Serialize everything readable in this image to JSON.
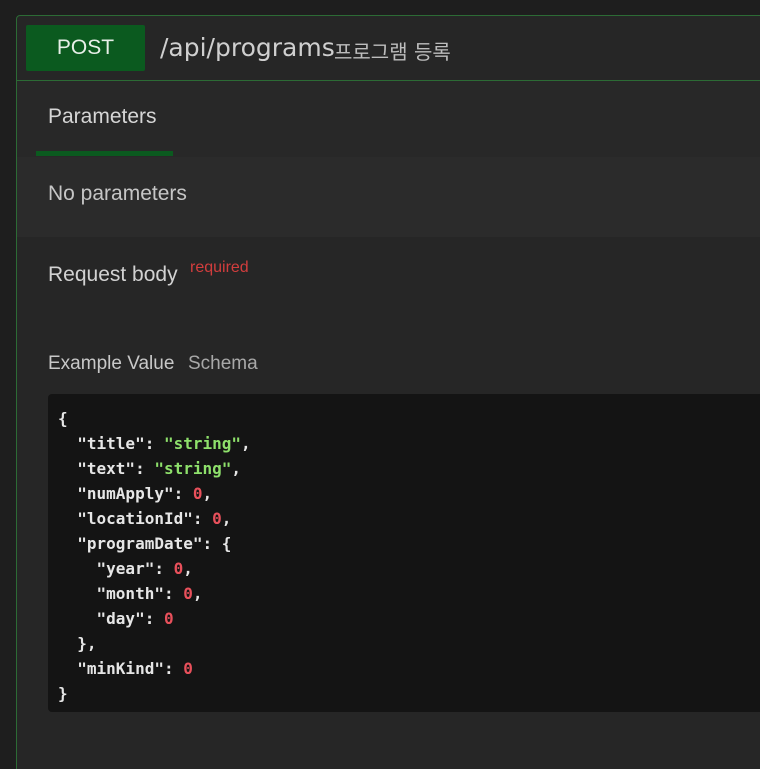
{
  "operation": {
    "method": "POST",
    "path": "/api/programs",
    "summary": "프로그램 등록"
  },
  "tabs": {
    "parameters_label": "Parameters"
  },
  "parameters": {
    "empty_text": "No parameters"
  },
  "request_body": {
    "title": "Request body",
    "required_label": "required",
    "example_tab": "Example Value",
    "schema_tab": "Schema"
  },
  "example_lines": [
    {
      "indent": 0,
      "parts": [
        {
          "t": "p",
          "v": "{"
        }
      ]
    },
    {
      "indent": 1,
      "parts": [
        {
          "t": "k",
          "v": "\"title\""
        },
        {
          "t": "p",
          "v": ": "
        },
        {
          "t": "s",
          "v": "\"string\""
        },
        {
          "t": "p",
          "v": ","
        }
      ]
    },
    {
      "indent": 1,
      "parts": [
        {
          "t": "k",
          "v": "\"text\""
        },
        {
          "t": "p",
          "v": ": "
        },
        {
          "t": "s",
          "v": "\"string\""
        },
        {
          "t": "p",
          "v": ","
        }
      ]
    },
    {
      "indent": 1,
      "parts": [
        {
          "t": "k",
          "v": "\"numApply\""
        },
        {
          "t": "p",
          "v": ": "
        },
        {
          "t": "n",
          "v": "0"
        },
        {
          "t": "p",
          "v": ","
        }
      ]
    },
    {
      "indent": 1,
      "parts": [
        {
          "t": "k",
          "v": "\"locationId\""
        },
        {
          "t": "p",
          "v": ": "
        },
        {
          "t": "n",
          "v": "0"
        },
        {
          "t": "p",
          "v": ","
        }
      ]
    },
    {
      "indent": 1,
      "parts": [
        {
          "t": "k",
          "v": "\"programDate\""
        },
        {
          "t": "p",
          "v": ": {"
        }
      ]
    },
    {
      "indent": 2,
      "parts": [
        {
          "t": "k",
          "v": "\"year\""
        },
        {
          "t": "p",
          "v": ": "
        },
        {
          "t": "n",
          "v": "0"
        },
        {
          "t": "p",
          "v": ","
        }
      ]
    },
    {
      "indent": 2,
      "parts": [
        {
          "t": "k",
          "v": "\"month\""
        },
        {
          "t": "p",
          "v": ": "
        },
        {
          "t": "n",
          "v": "0"
        },
        {
          "t": "p",
          "v": ","
        }
      ]
    },
    {
      "indent": 2,
      "parts": [
        {
          "t": "k",
          "v": "\"day\""
        },
        {
          "t": "p",
          "v": ": "
        },
        {
          "t": "n",
          "v": "0"
        }
      ]
    },
    {
      "indent": 1,
      "parts": [
        {
          "t": "p",
          "v": "},"
        }
      ]
    },
    {
      "indent": 1,
      "parts": [
        {
          "t": "k",
          "v": "\"minKind\""
        },
        {
          "t": "p",
          "v": ": "
        },
        {
          "t": "n",
          "v": "0"
        }
      ]
    },
    {
      "indent": 0,
      "parts": [
        {
          "t": "p",
          "v": "}"
        }
      ]
    }
  ],
  "colors": {
    "method_bg": "#0b5a1f",
    "border": "#2c6b35",
    "required": "#d23d3d",
    "json_string": "#8ee06b",
    "json_number": "#e8505b"
  }
}
